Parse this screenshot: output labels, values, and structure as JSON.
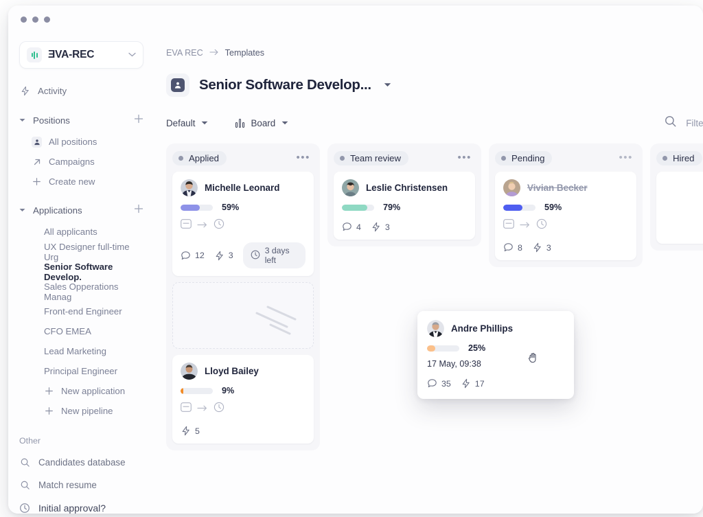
{
  "window": {
    "dots": 3
  },
  "sidebar": {
    "brand": {
      "name": "ƎVA-REC",
      "logo_icon": "bars-logo-icon",
      "chevron_icon": "chevron-down-icon"
    },
    "activity": {
      "label": "Activity",
      "icon": "lightning-icon"
    },
    "positions": {
      "label": "Positions",
      "collapse_icon": "triangle-down-icon",
      "add_icon": "plus-icon",
      "items": [
        {
          "label": "All positions",
          "icon": "person-icon"
        },
        {
          "label": "Campaigns",
          "icon": "arrow-up-right-icon"
        },
        {
          "label": "Create new",
          "icon": "plus-icon"
        }
      ]
    },
    "applications": {
      "label": "Applications",
      "collapse_icon": "triangle-down-icon",
      "add_icon": "plus-icon",
      "items": [
        {
          "label": "All applicants",
          "icon": "",
          "active": false
        },
        {
          "label": "UX Designer full-time Urg",
          "icon": "",
          "active": false
        },
        {
          "label": "Senior Software Develop.",
          "icon": "",
          "active": true
        },
        {
          "label": "Sales Opperations Manag",
          "icon": "",
          "active": false
        },
        {
          "label": "Front-end Engineer",
          "icon": "",
          "active": false
        },
        {
          "label": "CFO EMEA",
          "icon": "",
          "active": false
        },
        {
          "label": "Lead Marketing",
          "icon": "",
          "active": false
        },
        {
          "label": "Principal Engineer",
          "icon": "",
          "active": false
        },
        {
          "label": "New application",
          "icon": "plus-icon",
          "active": false
        },
        {
          "label": "New pipeline",
          "icon": "plus-icon",
          "active": false
        }
      ]
    },
    "other": {
      "label": "Other",
      "items": [
        {
          "label": "Candidates database",
          "icon": "search-icon"
        },
        {
          "label": "Match resume",
          "icon": "search-icon"
        },
        {
          "label": "Initial approval?",
          "icon": "clock-icon"
        }
      ]
    }
  },
  "header": {
    "breadcrumb": {
      "root": "EVA REC",
      "arrow_icon": "arrow-right-icon",
      "current": "Templates"
    },
    "title": "Senior Software Develop...",
    "title_icon": "person-badge-icon",
    "title_caret_icon": "caret-down-icon"
  },
  "toolbar": {
    "view_preset": "Default",
    "view_preset_caret": "caret-down-icon",
    "layout_icon": "kanban-icon",
    "layout": "Board",
    "layout_caret": "caret-down-icon",
    "search_icon": "search-icon",
    "filter_label": "Filter"
  },
  "board": {
    "columns": [
      {
        "title": "Applied",
        "dot_color": "#9297ab",
        "menu_icon": "more-horizontal-icon",
        "cards": [
          {
            "name": "Michelle Leonard",
            "percent": "59%",
            "percent_value": 59,
            "bar_color": "#8e92e8",
            "struck": false,
            "stage_icons": [
              "inbox-icon",
              "arrow-right-icon",
              "clock-icon"
            ],
            "comments_icon": "comment-icon",
            "comments": "12",
            "actions_icon": "lightning-icon",
            "actions": "3",
            "due_icon": "clock-icon",
            "due": "3 days left"
          },
          {
            "name": "Lloyd Bailey",
            "percent": "9%",
            "percent_value": 9,
            "bar_color": "#f28c28",
            "struck": false,
            "stage_icons": [
              "inbox-icon",
              "arrow-right-icon",
              "clock-icon"
            ],
            "actions_icon": "lightning-icon",
            "actions": "5"
          }
        ],
        "placeholder": {
          "icon": "motion-lines-icon"
        }
      },
      {
        "title": "Team review",
        "dot_color": "#9297ab",
        "menu_icon": "more-horizontal-icon",
        "cards": [
          {
            "name": "Leslie Christensen",
            "percent": "79%",
            "percent_value": 79,
            "bar_color": "#8fd9c3",
            "struck": false,
            "comments_icon": "comment-icon",
            "comments": "4",
            "actions_icon": "lightning-icon",
            "actions": "3"
          }
        ]
      },
      {
        "title": "Pending",
        "dot_color": "#9297ab",
        "menu_icon": "more-horizontal-icon",
        "cards": [
          {
            "name": "Vivian Becker",
            "percent": "59%",
            "percent_value": 59,
            "bar_color": "#4f5ef0",
            "struck": true,
            "stage_icons": [
              "inbox-icon",
              "arrow-right-icon",
              "clock-icon"
            ],
            "comments_icon": "comment-icon",
            "comments": "8",
            "actions_icon": "lightning-icon",
            "actions": "3"
          }
        ]
      },
      {
        "title": "Hired",
        "dot_color": "#9297ab",
        "menu_icon": "",
        "cards": []
      }
    ]
  },
  "drag_card": {
    "name": "Andre Phillips",
    "percent": "25%",
    "percent_value": 25,
    "bar_color": "#fbc08a",
    "date": "17 May, 09:38",
    "comments_icon": "comment-icon",
    "comments": "35",
    "actions_icon": "lightning-icon",
    "actions": "17",
    "cursor_icon": "grab-hand-cursor-icon"
  }
}
